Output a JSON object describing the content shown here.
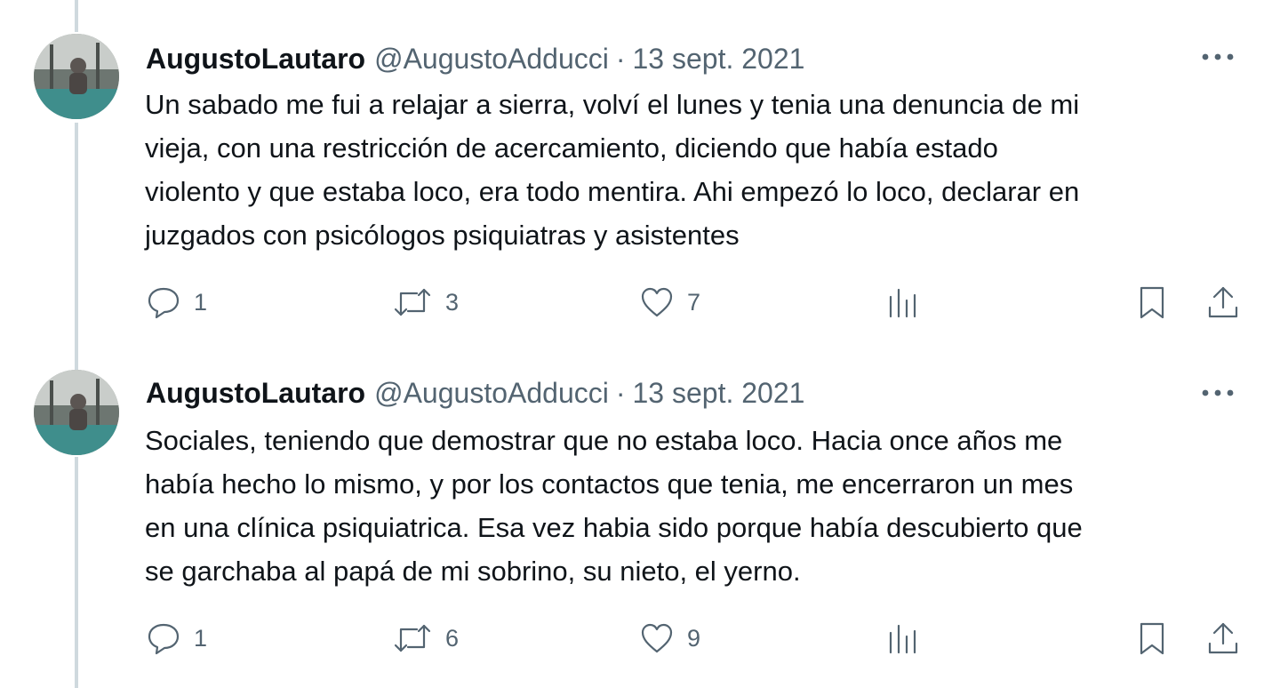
{
  "tweets": [
    {
      "author_name": "AugustoLautaro",
      "handle": "@AugustoAdducci",
      "separator": "·",
      "date": "13 sept. 2021",
      "text_lines": [
        "Un sabado me fui a relajar a sierra, volví el lunes y tenia una denuncia de mi",
        "vieja, con una restricción de acercamiento, diciendo que había estado",
        "violento y que estaba loco, era todo mentira. Ahi empezó lo loco, declarar en",
        "juzgados con psicólogos psiquiatras y asistentes"
      ],
      "replies": "1",
      "retweets": "3",
      "likes": "7"
    },
    {
      "author_name": "AugustoLautaro",
      "handle": "@AugustoAdducci",
      "separator": "·",
      "date": "13 sept. 2021",
      "text_lines": [
        "Sociales, teniendo que demostrar que no estaba loco. Hacia once años me",
        "había hecho lo mismo, y por los contactos que tenia, me encerraron un mes",
        "en una clínica psiquiatrica. Esa vez habia sido porque había descubierto que",
        "se garchaba al papá de mi sobrino, su nieto, el yerno."
      ],
      "replies": "1",
      "retweets": "6",
      "likes": "9"
    }
  ],
  "icons": {
    "reply": "speech-bubble-icon",
    "retweet": "retweet-arrows-icon",
    "like": "heart-icon",
    "views": "bar-chart-icon",
    "bookmark": "bookmark-icon",
    "share": "upload-arrow-icon",
    "more": "ellipsis-icon"
  },
  "colors": {
    "text": "#0f1419",
    "secondary": "#536471",
    "thread_line": "#cfd9de"
  }
}
